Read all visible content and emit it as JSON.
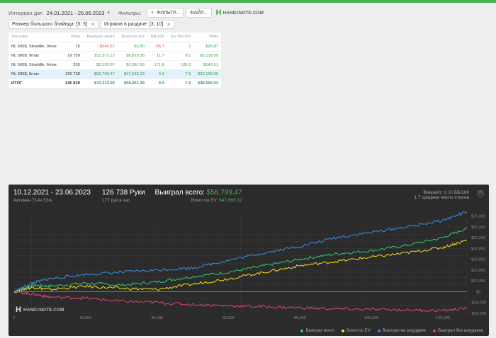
{
  "filters": {
    "interval_label": "Интервал дат:",
    "interval_value": "24.01.2021 - 25.06.2023",
    "filters_label": "Фильтры:",
    "filter_button": "ФИЛЬТР...",
    "file_button": "ФАЙЛ...",
    "logo_text_a": "HAND",
    "logo_text_b": "2",
    "logo_text_c": "NOTE.COM"
  },
  "chips": [
    {
      "label": "Размер большого блайнда: [5; 5]"
    },
    {
      "label": "Игроков в раздаче: [3; 10]"
    }
  ],
  "table": {
    "headers": [
      "Тип игры",
      "Руки",
      "Выиграл всего",
      "Всего по EV",
      "ББ/100",
      "EV ББ/100",
      "Рейк"
    ],
    "rows": [
      {
        "type": "NL 500$, Straddle, 9max",
        "hands": "76",
        "won": "-$249.57",
        "ev": "$3.80",
        "bb100": "-55.7",
        "evbb": "1",
        "rake": "$26.87"
      },
      {
        "type": "NL 500$, 9max",
        "hands": "19 759",
        "won": "$11,573.12",
        "ev": "$8,019.28",
        "bb100": "11.7",
        "evbb": "8.1",
        "rake": "$5,139.99"
      },
      {
        "type": "NL 500$, Straddle, 6max",
        "hands": "255",
        "won": "$2,190.07",
        "ev": "$2,361.99",
        "bb100": "171.8",
        "evbb": "185.3",
        "rake": "$143.51"
      },
      {
        "type": "NL 500$, 6max",
        "hands": "126 738",
        "won": "$58,799.47",
        "ev": "$47,666.32",
        "bb100": "9.3",
        "evbb": "7.5",
        "rake": "$33,195.66"
      }
    ],
    "total": {
      "type": "ИТОГ",
      "hands": "146 828",
      "won": "$72,313.09",
      "ev": "$58,051.39",
      "bb100": "9.9",
      "evbb": "7.9",
      "rake": "$38,506.03"
    }
  },
  "panel": {
    "period": "10.12.2021 - 23.06.2023",
    "active": "Активен 714ч 53м",
    "hands": "126 738 Руки",
    "hands_per_hour": "177 рук в час",
    "won_label": "Выиграл всего:",
    "won_value": "$58,799.47",
    "ev_label": "Всего по EV:",
    "ev_value": "$47,666.32",
    "winrate_label": "Винрейт:",
    "winrate_value": "9.28",
    "winrate_unit": "ББ/100",
    "tables_avg": "1.7 среднее число столов",
    "watermark_a": "HAND",
    "watermark_b": "2",
    "watermark_c": "NOTE.COM"
  },
  "chart_data": {
    "type": "line",
    "x_ticks": [
      "0",
      "20,000",
      "40,000",
      "60,000",
      "80,000",
      "100,000",
      "120,000"
    ],
    "y_ticks": [
      "$70,000",
      "$60,000",
      "$50,000",
      "$40,000",
      "$30,000",
      "$20,000",
      "$10,000",
      "$0",
      "-$10,000",
      "-$20,000"
    ],
    "xlim": [
      0,
      126738
    ],
    "ylim": [
      -20000,
      73000
    ],
    "grid": true,
    "legend_position": "bottom-right",
    "series": [
      {
        "name": "Выиграл всего",
        "color": "#2ecc71",
        "x": [
          0,
          5000,
          10000,
          20000,
          30000,
          40000,
          50000,
          60000,
          70000,
          80000,
          90000,
          100000,
          110000,
          120000,
          126738
        ],
        "y": [
          0,
          6000,
          5000,
          8000,
          6000,
          9000,
          14000,
          18000,
          24000,
          30000,
          35000,
          38000,
          43000,
          50000,
          58800
        ]
      },
      {
        "name": "Всего по EV",
        "color": "#f1e21b",
        "x": [
          0,
          5000,
          10000,
          20000,
          30000,
          40000,
          50000,
          60000,
          70000,
          80000,
          90000,
          100000,
          110000,
          120000,
          126738
        ],
        "y": [
          0,
          4000,
          2000,
          5000,
          3000,
          2000,
          7000,
          12000,
          18000,
          24000,
          28000,
          32000,
          36000,
          41000,
          47700
        ]
      },
      {
        "name": "Выиграл на шоудауне",
        "color": "#3a8ee6",
        "x": [
          0,
          5000,
          10000,
          20000,
          30000,
          40000,
          50000,
          60000,
          70000,
          80000,
          90000,
          100000,
          110000,
          120000,
          126738
        ],
        "y": [
          0,
          8000,
          12000,
          16000,
          18000,
          20000,
          22000,
          29000,
          36000,
          42000,
          50000,
          55000,
          60000,
          66000,
          74000
        ]
      },
      {
        "name": "Выиграл без шоудауна",
        "color": "#e0447a",
        "x": [
          0,
          5000,
          10000,
          20000,
          30000,
          40000,
          50000,
          60000,
          70000,
          80000,
          90000,
          100000,
          110000,
          120000,
          126738
        ],
        "y": [
          0,
          -2000,
          -5000,
          -6000,
          -9000,
          -10000,
          -12000,
          -13000,
          -14000,
          -15000,
          -16000,
          -16500,
          -17000,
          -17500,
          -15500
        ]
      }
    ]
  }
}
